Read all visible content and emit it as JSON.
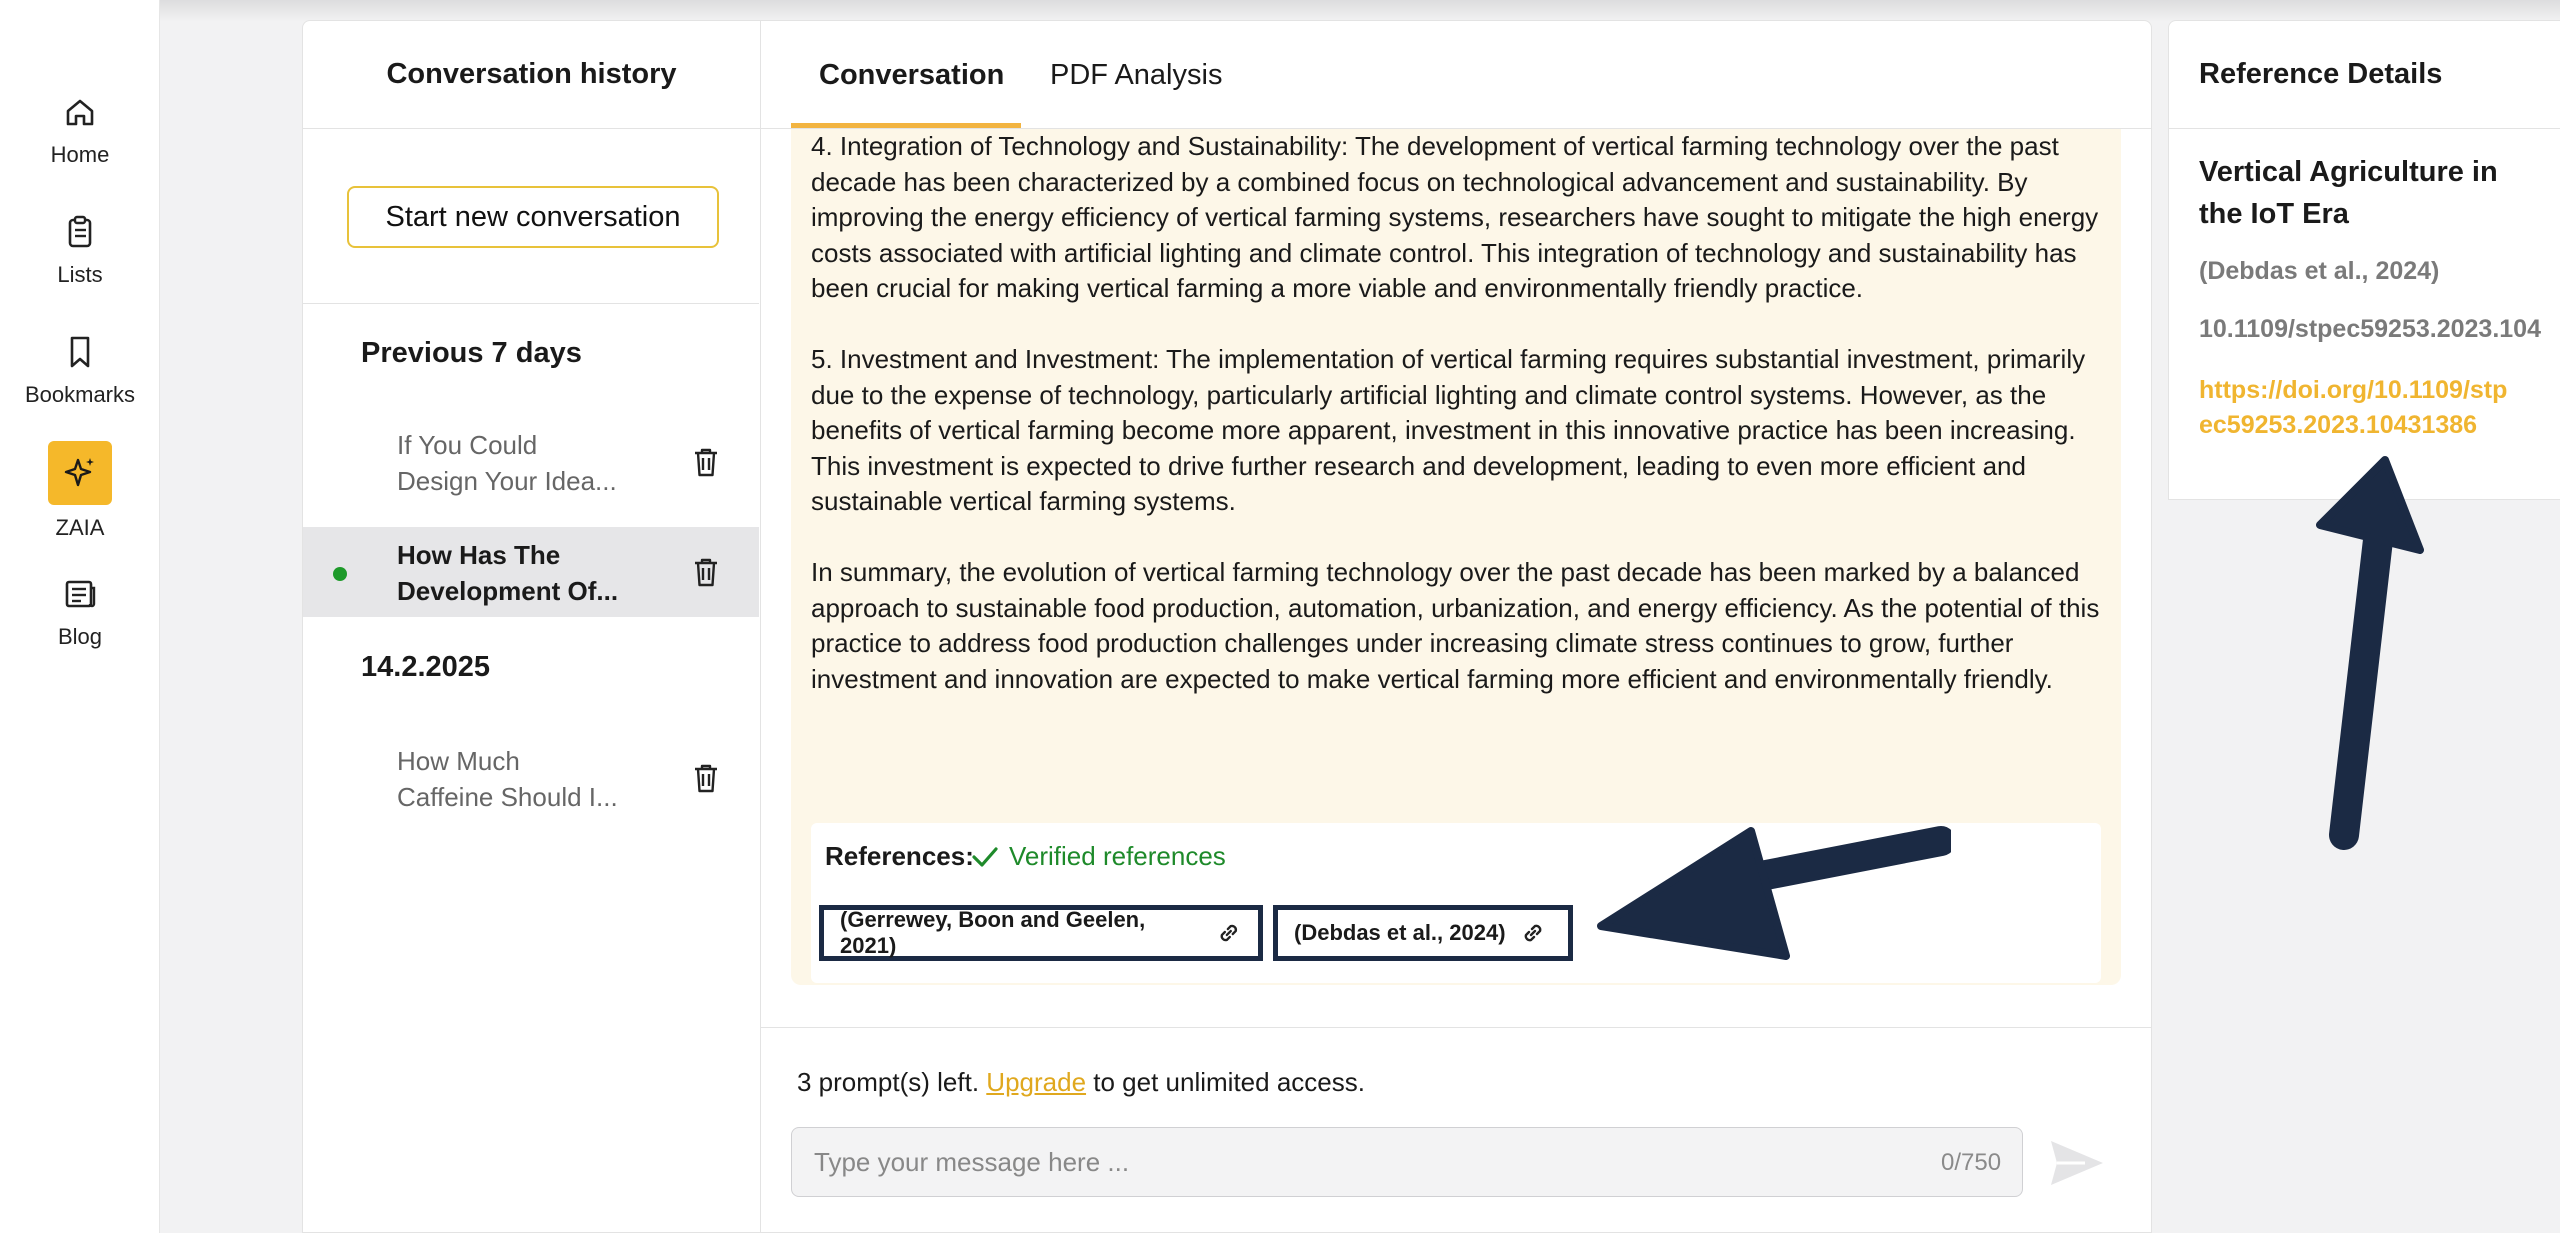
{
  "nav": {
    "items": [
      {
        "label": "Home",
        "icon": "home-icon"
      },
      {
        "label": "Lists",
        "icon": "clipboard-icon"
      },
      {
        "label": "Bookmarks",
        "icon": "bookmark-icon"
      },
      {
        "label": "ZAIA",
        "icon": "sparkle-icon"
      },
      {
        "label": "Blog",
        "icon": "newspaper-icon"
      }
    ],
    "accent": "#f5b82a"
  },
  "history": {
    "title": "Conversation history",
    "new_button": "Start new conversation",
    "groups": [
      {
        "title": "Previous 7 days",
        "items": [
          {
            "title": "If You Could\nDesign Your Idea...",
            "active": false
          },
          {
            "title": "How Has The\nDevelopment Of...",
            "active": true
          }
        ]
      },
      {
        "title": "14.2.2025",
        "items": [
          {
            "title": "How Much\nCaffeine Should I...",
            "active": false
          }
        ]
      }
    ]
  },
  "tabs": [
    {
      "label": "Conversation",
      "active": true
    },
    {
      "label": "PDF Analysis",
      "active": false
    }
  ],
  "message": {
    "paragraphs": [
      "4. Integration of Technology and Sustainability: The development of vertical farming technology over the past decade has been characterized by a combined focus on technological advancement and sustainability. By improving the energy efficiency of vertical farming systems, researchers have sought to mitigate the high energy costs associated with artificial lighting and climate control. This integration of technology and sustainability has been crucial for making vertical farming a more viable and environmentally friendly practice.",
      "5. Investment and Investment: The implementation of vertical farming requires substantial investment, primarily due to the expense of technology, particularly artificial lighting and climate control systems. However, as the benefits of vertical farming become more apparent, investment in this innovative practice has been increasing. This investment is expected to drive further research and development, leading to even more efficient and sustainable vertical farming systems.",
      "In summary, the evolution of vertical farming technology over the past decade has been marked by a balanced approach to sustainable food production, automation, urbanization, and energy efficiency. As the potential of this practice to address food production challenges under increasing climate stress continues to grow, further investment and innovation are expected to make vertical farming more efficient and environmentally friendly."
    ],
    "references_label": "References:",
    "verified_label": "Verified references",
    "references": [
      "(Gerrewey, Boon and Geelen, 2021)",
      "(Debdas et al., 2024)"
    ]
  },
  "footer": {
    "prompts_prefix": "3 prompt(s) left.",
    "upgrade": "Upgrade",
    "prompts_suffix": "to get unlimited access.",
    "input_placeholder": "Type your message here ...",
    "counter": "0/750"
  },
  "reference_details": {
    "heading": "Reference Details",
    "title": "Vertical Agriculture in the IoT Era",
    "citation": "(Debdas et al., 2024)",
    "doi": "10.1109/stpec59253.2023.104",
    "url": "https://doi.org/10.1109/stpec59253.2023.10431386"
  },
  "colors": {
    "accent_yellow": "#f2b441",
    "verified_green": "#1e8a2a",
    "annotation_navy": "#1b2a44",
    "card_bg": "#fdf7e8"
  }
}
